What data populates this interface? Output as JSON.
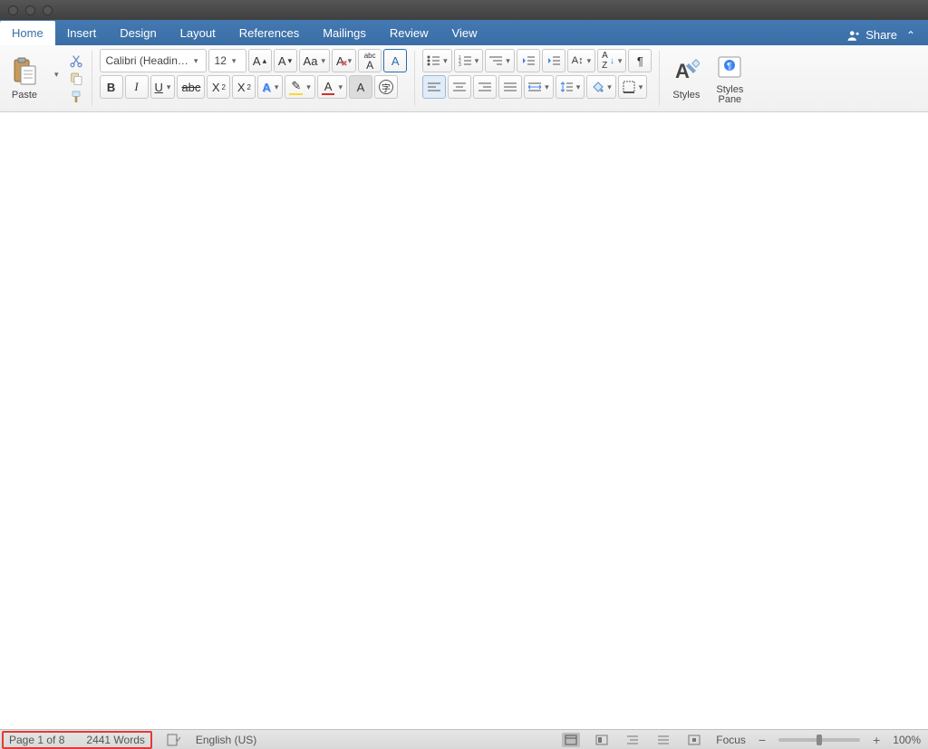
{
  "tabs": [
    "Home",
    "Insert",
    "Design",
    "Layout",
    "References",
    "Mailings",
    "Review",
    "View"
  ],
  "activeTab": "Home",
  "share": "Share",
  "clipboard": {
    "paste": "Paste"
  },
  "font": {
    "name": "Calibri (Headin…",
    "size": "12"
  },
  "styles": {
    "styles": "Styles",
    "pane": "Styles\nPane"
  },
  "status": {
    "page": "Page 1 of 8",
    "words": "2441 Words",
    "language": "English (US)",
    "focus": "Focus",
    "zoom": "100%"
  }
}
